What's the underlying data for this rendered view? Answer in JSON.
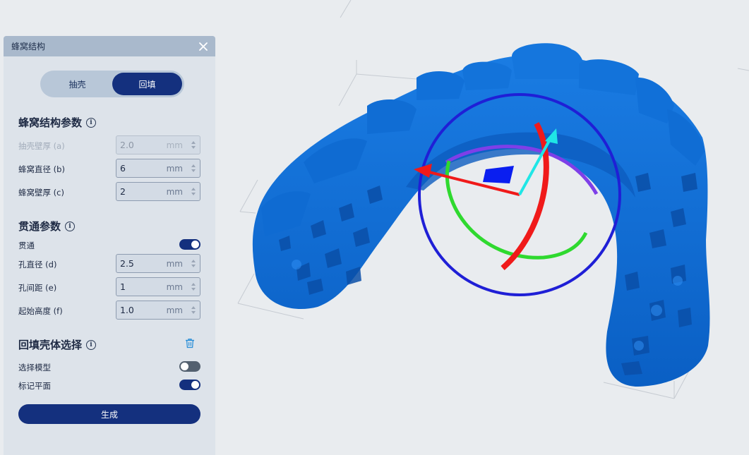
{
  "panel": {
    "title": "蜂窝结构",
    "close_icon": "close-icon",
    "tabs": [
      {
        "label": "抽壳",
        "active": false
      },
      {
        "label": "回填",
        "active": true
      }
    ],
    "honeycomb_section": {
      "title": "蜂窝结构参数",
      "info_icon": "info-icon",
      "fields": [
        {
          "label": "抽壳壁厚 (a)",
          "value": "2.0",
          "unit": "mm",
          "disabled": true
        },
        {
          "label": "蜂窝直径 (b)",
          "value": "6",
          "unit": "mm",
          "disabled": false
        },
        {
          "label": "蜂窝壁厚 (c)",
          "value": "2",
          "unit": "mm",
          "disabled": false
        }
      ]
    },
    "through_section": {
      "title": "贯通参数",
      "info_icon": "info-icon",
      "toggle_label": "贯通",
      "toggle_on": true,
      "fields": [
        {
          "label": "孔直径 (d)",
          "value": "2.5",
          "unit": "mm"
        },
        {
          "label": "孔间距 (e)",
          "value": "1",
          "unit": "mm"
        },
        {
          "label": "起始高度 (f)",
          "value": "1.0",
          "unit": "mm"
        }
      ]
    },
    "backfill_section": {
      "title": "回填壳体选择",
      "info_icon": "info-icon",
      "trash_icon": "trash-icon",
      "toggles": [
        {
          "label": "选择模型",
          "on": false
        },
        {
          "label": "标记平面",
          "on": true
        }
      ]
    },
    "generate_label": "生成"
  },
  "colors": {
    "primary": "#14307e",
    "panel_bg": "#dde3ea",
    "header_bg": "#a9b9cc",
    "model_blue": "#0f6fd6",
    "viewport_bg": "#e9ecef"
  }
}
